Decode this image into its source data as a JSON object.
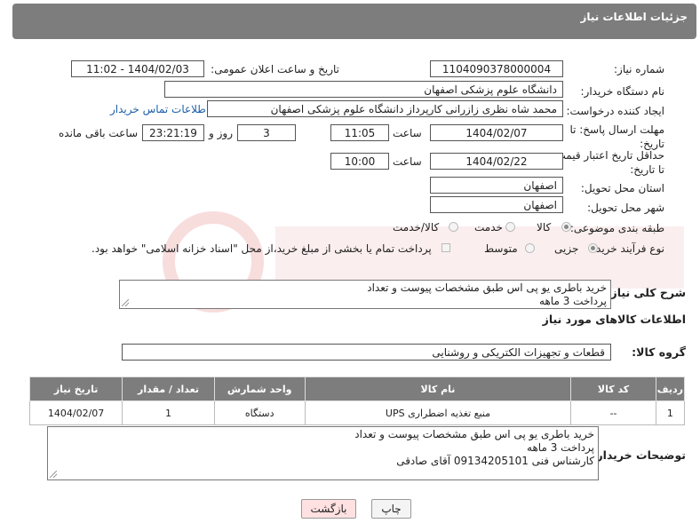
{
  "header": {
    "title": "جزئیات اطلاعات نیاز"
  },
  "fields": {
    "need_number": {
      "label": "شماره نیاز:",
      "value": "1104090378000004"
    },
    "announce": {
      "label": "تاریخ و ساعت اعلان عمومی:",
      "value": "1404/02/03 - 11:02"
    },
    "buyer_org": {
      "label": "نام دستگاه خریدار:",
      "value": "دانشگاه علوم پزشکی اصفهان"
    },
    "requester": {
      "label": "ایجاد کننده درخواست:",
      "value": "محمد شاه نظری زازرانی کارپرداز دانشگاه علوم پزشکی اصفهان",
      "contact_link": "اطلاعات تماس خریدار"
    },
    "reply_deadline": {
      "label_line1": "مهلت ارسال پاسخ: تا",
      "label_line2": "تاریخ:",
      "date": "1404/02/07",
      "time_label": "ساعت",
      "time": "11:05",
      "days": "3",
      "days_label": "روز و",
      "remaining": "23:21:19",
      "remaining_label": "ساعت باقی مانده"
    },
    "price_validity": {
      "label_line1": "حداقل تاریخ اعتبار قیمت:",
      "label_line2": "تا تاریخ:",
      "date": "1404/02/22",
      "time_label": "ساعت",
      "time": "10:00"
    },
    "province": {
      "label": "استان محل تحویل:",
      "value": "اصفهان"
    },
    "city": {
      "label": "شهر محل تحویل:",
      "value": "اصفهان"
    },
    "category": {
      "label": "طبقه بندی موضوعی:",
      "options": [
        "کالا",
        "خدمت",
        "کالا/خدمت"
      ],
      "selected": "کالا"
    },
    "process": {
      "label": "نوع فرآیند خرید :",
      "options": [
        "جزیی",
        "متوسط"
      ],
      "selected": "جزیی",
      "note": "پرداخت تمام یا بخشی از مبلغ خرید،از محل \"اسناد خزانه اسلامی\" خواهد بود."
    }
  },
  "description": {
    "label": "شرح کلی نیاز:",
    "line1": "خرید باطری یو پی اس طبق مشخصات پیوست و تعداد",
    "line2": "پرداخت 3 ماهه"
  },
  "goods_section": {
    "title": "اطلاعات کالاهای مورد نیاز",
    "group_label": "گروه کالا:",
    "group_value": "قطعات و تجهیزات الکتریکی و روشنایی"
  },
  "table": {
    "headers": {
      "row": "ردیف",
      "code": "کد کالا",
      "name": "نام کالا",
      "unit": "واحد شمارش",
      "qty": "تعداد / مقدار",
      "date": "تاریخ نیاز"
    },
    "rows": [
      {
        "row": "1",
        "code": "--",
        "name": "منبع تغذیه اضطراری UPS",
        "unit": "دستگاه",
        "qty": "1",
        "date": "1404/02/07"
      }
    ]
  },
  "buyer_notes": {
    "label": "توضیحات خریدار:",
    "line1": "خرید باطری یو پی اس طبق مشخصات پیوست و تعداد",
    "line2": "پرداخت 3 ماهه",
    "line3": "کارشناس فنی 09134205101 آقای صادقی"
  },
  "buttons": {
    "print": "چاپ",
    "back": "بازگشت"
  },
  "colors": {
    "header_bg": "#7d7d7d",
    "link": "#1d5fa8",
    "back_bg": "#ffe1e1"
  }
}
